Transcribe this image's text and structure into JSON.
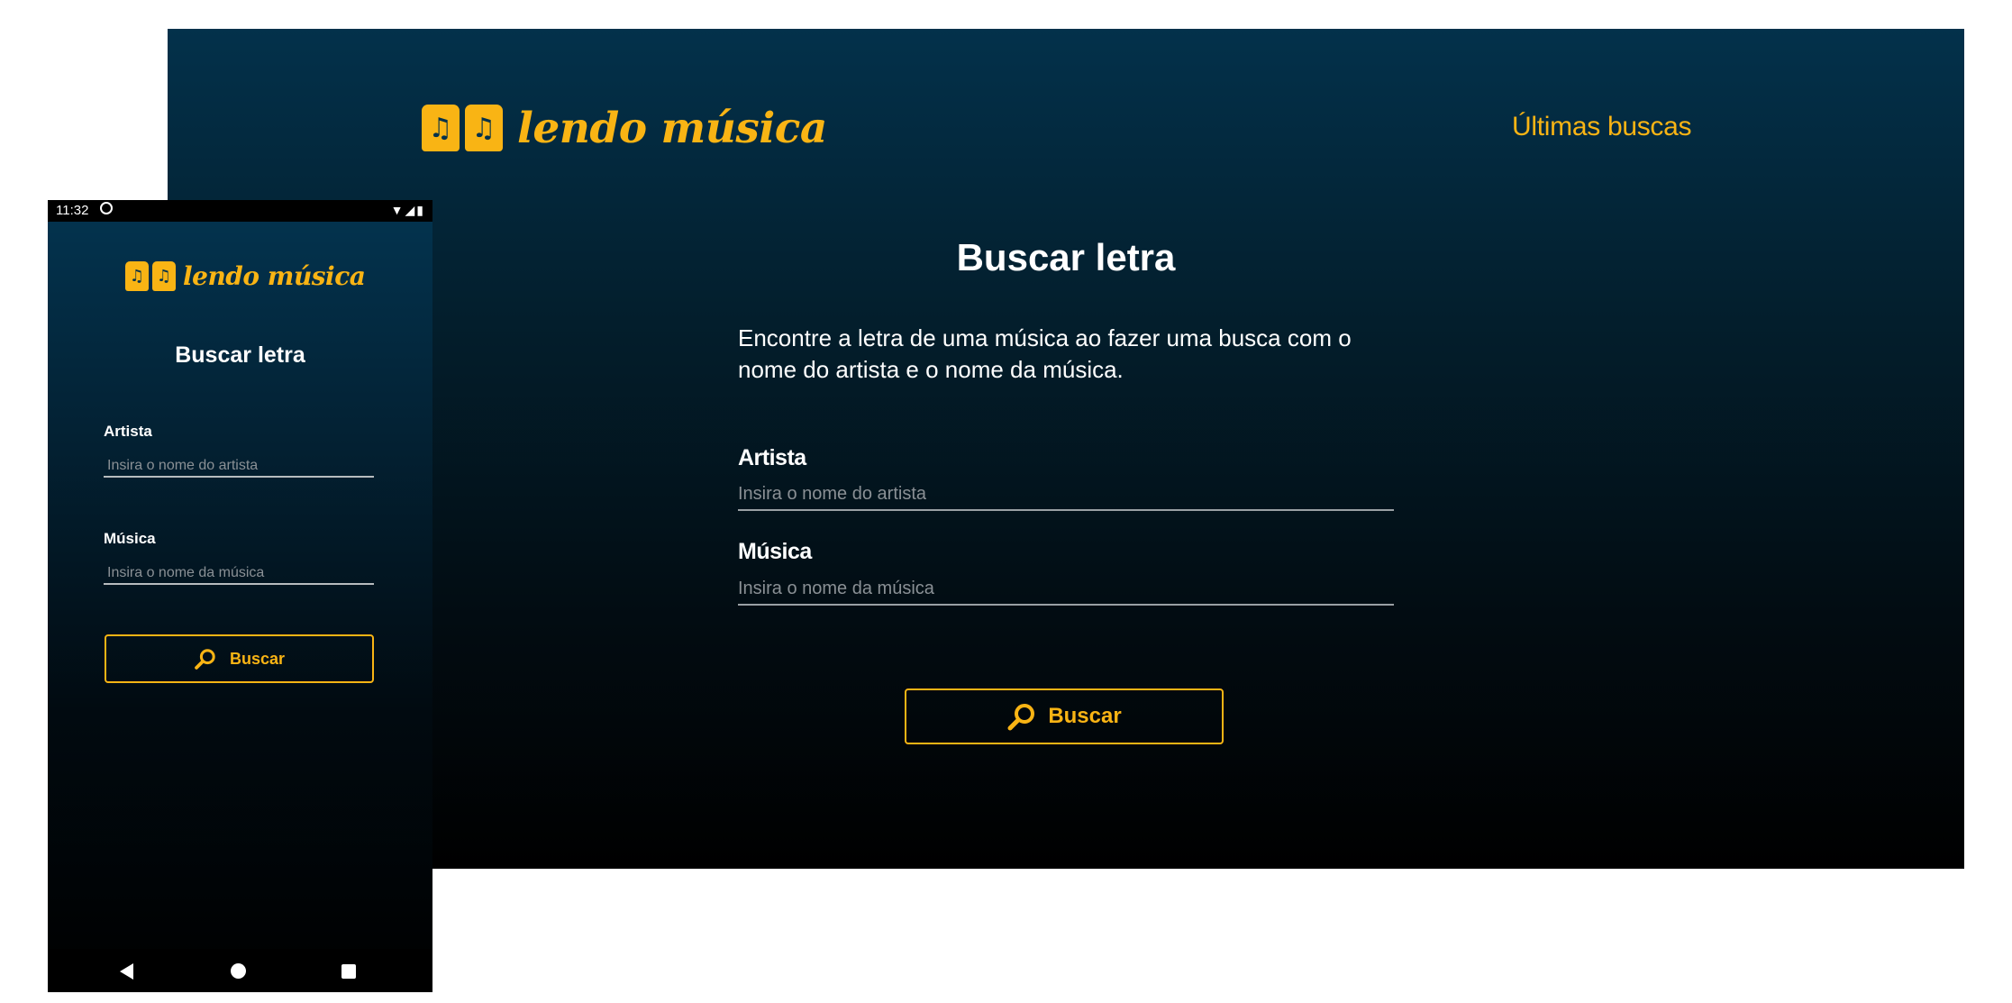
{
  "desktop": {
    "logo": {
      "glyph": "♫",
      "text": "lendo música"
    },
    "nav": {
      "recent_searches": "Últimas buscas"
    },
    "title": "Buscar letra",
    "description": "Encontre a letra de uma música ao fazer uma busca com o nome do artista e o nome da música.",
    "form": {
      "artist_label": "Artista",
      "artist_placeholder": "Insira o nome do artista",
      "song_label": "Música",
      "song_placeholder": "Insira o nome da música",
      "search_button": "Buscar"
    }
  },
  "mobile": {
    "status_bar": {
      "time": "11:32"
    },
    "logo": {
      "glyph": "♫",
      "text": "lendo música"
    },
    "title": "Buscar letra",
    "form": {
      "artist_label": "Artista",
      "artist_placeholder": "Insira o nome do artista",
      "song_label": "Música",
      "song_placeholder": "Insira o nome da música",
      "search_button": "Buscar"
    }
  },
  "colors": {
    "accent": "#f9b414",
    "background_top": "#03314b",
    "background_bottom": "#000000",
    "text": "#ffffff"
  },
  "icons": [
    "music-note-icon",
    "search-icon",
    "wifi-icon",
    "signal-icon",
    "battery-icon",
    "sync-icon",
    "back-icon",
    "home-icon",
    "recent-apps-icon"
  ]
}
